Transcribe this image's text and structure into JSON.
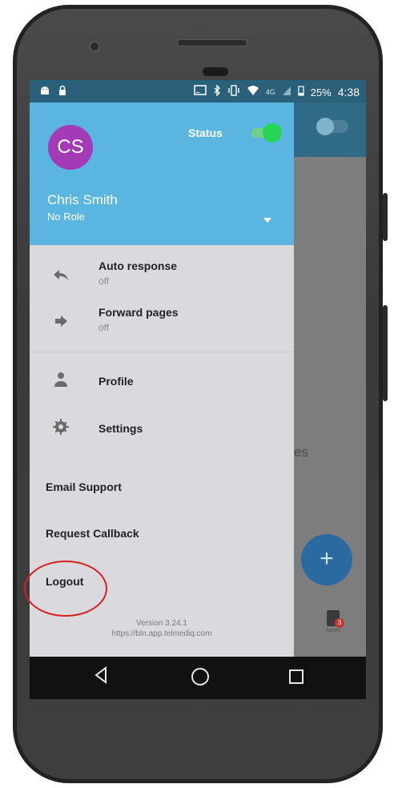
{
  "status_bar": {
    "battery": "25%",
    "time": "4:38",
    "network": "4G"
  },
  "drawer": {
    "avatar_initials": "CS",
    "status_label": "Status",
    "user_name": "Chris Smith",
    "user_role": "No Role",
    "items": {
      "auto_response": {
        "title": "Auto response",
        "sub": "off"
      },
      "forward_pages": {
        "title": "Forward pages",
        "sub": "off"
      },
      "profile": {
        "title": "Profile"
      },
      "settings": {
        "title": "Settings"
      }
    },
    "email_support": "Email Support",
    "request_callback": "Request Callback",
    "logout": "Logout",
    "version": "Version 3.24.1",
    "url": "https://bln.app.telmediq.com"
  },
  "background": {
    "partial_text": "es",
    "fab_symbol": "+",
    "news_label": "News",
    "news_badge": "3"
  },
  "colors": {
    "header_blue": "#5ab6e0",
    "avatar_purple": "#a43ab6",
    "status_green": "#27d655",
    "highlight_red": "#d62020"
  }
}
